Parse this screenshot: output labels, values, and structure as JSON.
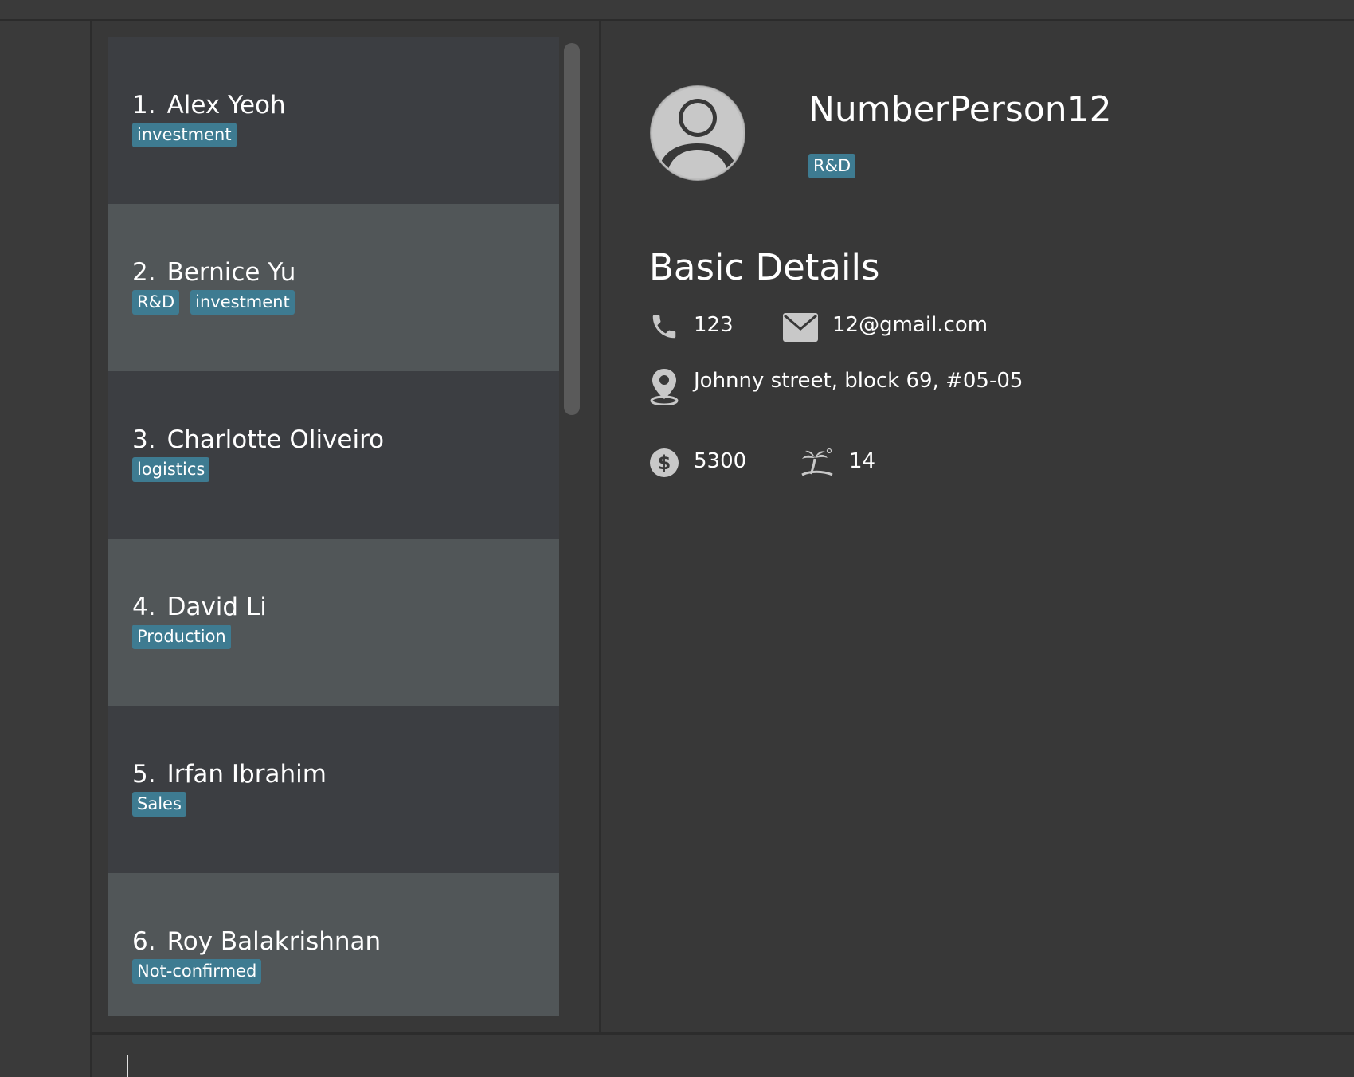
{
  "persons": [
    {
      "index": "1.",
      "name": "Alex Yeoh",
      "tags": [
        "investment"
      ]
    },
    {
      "index": "2.",
      "name": "Bernice Yu",
      "tags": [
        "R&D",
        "investment"
      ]
    },
    {
      "index": "3.",
      "name": "Charlotte Oliveiro",
      "tags": [
        "logistics"
      ]
    },
    {
      "index": "4.",
      "name": "David Li",
      "tags": [
        "Production"
      ]
    },
    {
      "index": "5.",
      "name": "Irfan Ibrahim",
      "tags": [
        "Sales"
      ]
    },
    {
      "index": "6.",
      "name": "Roy Balakrishnan",
      "tags": [
        "Not-confirmed"
      ]
    }
  ],
  "detail": {
    "name": "NumberPerson12",
    "tags": [
      "R&D"
    ],
    "section_title": "Basic Details",
    "phone": "123",
    "email": "12@gmail.com",
    "address": "Johnny street, block 69, #05-05",
    "salary": "5300",
    "leave": "14"
  },
  "icons": {
    "avatar": "avatar-icon",
    "phone": "phone-icon",
    "email": "email-icon",
    "address": "location-pin-icon",
    "salary": "dollar-icon",
    "leave": "beach-palm-icon"
  },
  "command_input": {
    "value": ""
  },
  "colors": {
    "background": "#383838",
    "card_odd": "#3c3e42",
    "card_even": "#515658",
    "tag": "#3e7b91",
    "icon": "#c8c8c8"
  }
}
